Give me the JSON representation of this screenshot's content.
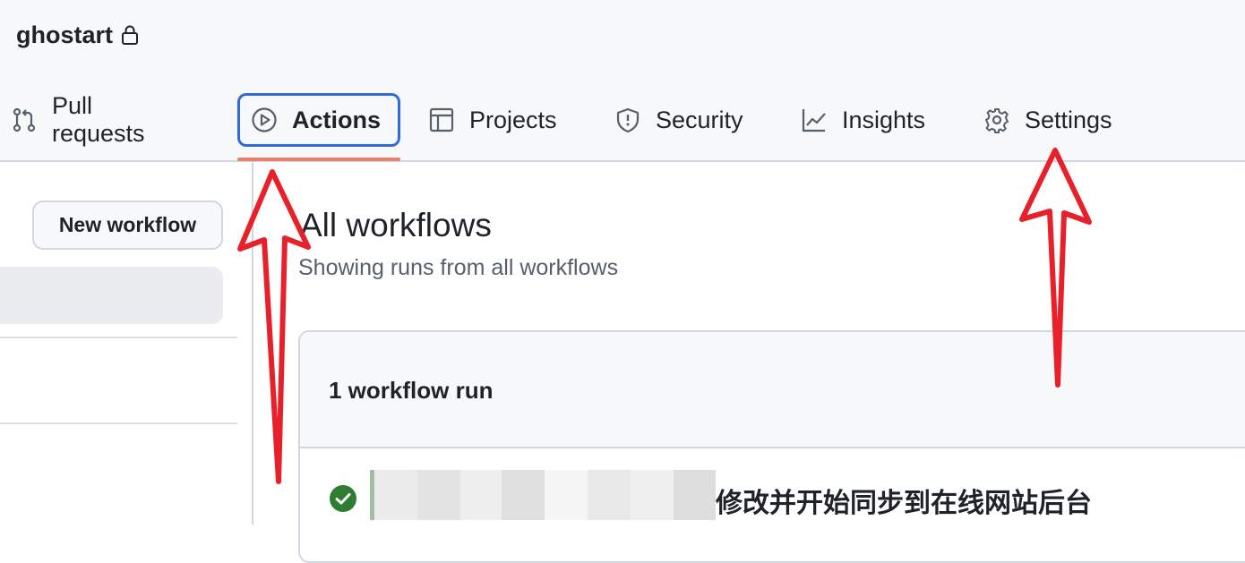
{
  "repo": {
    "name": "ghostart",
    "icon": "lock-icon"
  },
  "tabs": [
    {
      "label": "Pull requests",
      "icon": "git-pull-request-icon"
    },
    {
      "label": "Actions",
      "icon": "play-circle-icon",
      "active": true
    },
    {
      "label": "Projects",
      "icon": "table-icon"
    },
    {
      "label": "Security",
      "icon": "shield-icon"
    },
    {
      "label": "Insights",
      "icon": "graph-icon"
    },
    {
      "label": "Settings",
      "icon": "gear-icon"
    }
  ],
  "sidebar": {
    "new_workflow_label": "New workflow"
  },
  "main": {
    "title": "All workflows",
    "subtitle": "Showing runs from all workflows",
    "run_count": "1 workflow run",
    "runs": [
      {
        "status": "success",
        "title": "修改并开始同步到在线网站后台"
      }
    ]
  },
  "colors": {
    "accent": "#2f6cd8",
    "success": "#2e7d32",
    "annotation_arrow": "#e8202a",
    "underline": "#e8806a"
  }
}
